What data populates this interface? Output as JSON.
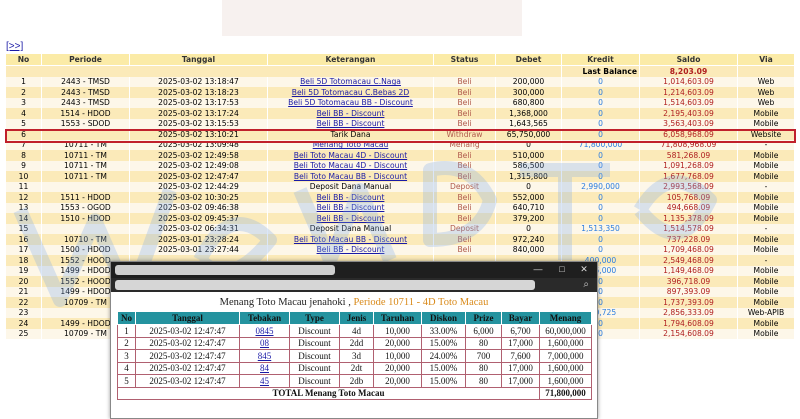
{
  "expand_label": "[>>]",
  "headers": [
    "No",
    "Periode",
    "Tanggal",
    "Keterangan",
    "Status",
    "Debet",
    "Kredit",
    "Saldo",
    "Via"
  ],
  "last_balance": {
    "label": "Last Balance",
    "value": "8,203.09"
  },
  "rows": [
    {
      "no": "1",
      "periode": "2443 - TMSD",
      "tanggal": "2025-03-02 13:18:47",
      "ket": "Beli 5D Totomacau C.Naga",
      "link": true,
      "status": "Beli",
      "debet": "200,000",
      "kredit": "0",
      "saldo": "1,014,603.09",
      "via": "Web"
    },
    {
      "no": "2",
      "periode": "2443 - TMSD",
      "tanggal": "2025-03-02 13:18:23",
      "ket": "Beli 5D Totomacau C.Bebas 2D",
      "link": true,
      "status": "Beli",
      "debet": "300,000",
      "kredit": "0",
      "saldo": "1,214,603.09",
      "via": "Web"
    },
    {
      "no": "3",
      "periode": "2443 - TMSD",
      "tanggal": "2025-03-02 13:17:53",
      "ket": "Beli 5D Totomacau BB - Discount",
      "link": true,
      "status": "Beli",
      "debet": "680,800",
      "kredit": "0",
      "saldo": "1,514,603.09",
      "via": "Web"
    },
    {
      "no": "4",
      "periode": "1514 - HDOD",
      "tanggal": "2025-03-02 13:17:24",
      "ket": "Beli BB - Discount",
      "link": true,
      "status": "Beli",
      "debet": "1,368,000",
      "kredit": "0",
      "saldo": "2,195,403.09",
      "via": "Mobile"
    },
    {
      "no": "5",
      "periode": "1553 - SDOD",
      "tanggal": "2025-03-02 13:15:53",
      "ket": "Beli BB - Discount",
      "link": true,
      "status": "Beli",
      "debet": "1,643,565",
      "kredit": "0",
      "saldo": "3,563,403.09",
      "via": "Mobile"
    },
    {
      "no": "6",
      "periode": "",
      "tanggal": "2025-03-02 13:10:21",
      "ket": "Tarik Dana",
      "link": false,
      "status": "Withdraw",
      "debet": "65,750,000",
      "kredit": "0",
      "saldo": "6,058,968.09",
      "via": "Website"
    },
    {
      "no": "7",
      "periode": "10711 - TM",
      "tanggal": "2025-03-02 13:09:48",
      "ket": "Menang Toto Macau",
      "link": true,
      "status": "Menang",
      "debet": "0",
      "kredit": "71,800,000",
      "saldo": "71,808,968.09",
      "via": "-"
    },
    {
      "no": "8",
      "periode": "10711 - TM",
      "tanggal": "2025-03-02 12:49:58",
      "ket": "Beli Toto Macau 4D - Discount",
      "link": true,
      "status": "Beli",
      "debet": "510,000",
      "kredit": "0",
      "saldo": "581,268.09",
      "via": "Mobile"
    },
    {
      "no": "9",
      "periode": "10711 - TM",
      "tanggal": "2025-03-02 12:49:08",
      "ket": "Beli Toto Macau 4D - Discount",
      "link": true,
      "status": "Beli",
      "debet": "586,500",
      "kredit": "0",
      "saldo": "1,091,268.09",
      "via": "Mobile"
    },
    {
      "no": "10",
      "periode": "10711 - TM",
      "tanggal": "2025-03-02 12:47:47",
      "ket": "Beli Toto Macau BB - Discount",
      "link": true,
      "status": "Beli",
      "debet": "1,315,800",
      "kredit": "0",
      "saldo": "1,677,768.09",
      "via": "Mobile"
    },
    {
      "no": "11",
      "periode": "",
      "tanggal": "2025-03-02 12:44:29",
      "ket": "Deposit Dana Manual",
      "link": false,
      "status": "Deposit",
      "debet": "0",
      "kredit": "2,990,000",
      "saldo": "2,993,568.09",
      "via": "-"
    },
    {
      "no": "12",
      "periode": "1511 - HDOD",
      "tanggal": "2025-03-02 10:30:25",
      "ket": "Beli BB - Discount",
      "link": true,
      "status": "Beli",
      "debet": "552,000",
      "kredit": "0",
      "saldo": "105,768.09",
      "via": "Mobile"
    },
    {
      "no": "13",
      "periode": "1553 - OGOD",
      "tanggal": "2025-03-02 09:46:38",
      "ket": "Beli BB - Discount",
      "link": true,
      "status": "Beli",
      "debet": "640,710",
      "kredit": "0",
      "saldo": "494,668.09",
      "via": "Mobile"
    },
    {
      "no": "14",
      "periode": "1510 - HDOD",
      "tanggal": "2025-03-02 09:45:37",
      "ket": "Beli BB - Discount",
      "link": true,
      "status": "Beli",
      "debet": "379,200",
      "kredit": "0",
      "saldo": "1,135,378.09",
      "via": "Mobile"
    },
    {
      "no": "15",
      "periode": "",
      "tanggal": "2025-03-02 06:34:31",
      "ket": "Deposit Dana Manual",
      "link": false,
      "status": "Deposit",
      "debet": "0",
      "kredit": "1,513,350",
      "saldo": "1,514,578.09",
      "via": "-"
    },
    {
      "no": "16",
      "periode": "10710 - TM",
      "tanggal": "2025-03-01 23:28:24",
      "ket": "Beli Toto Macau BB - Discount",
      "link": true,
      "status": "Beli",
      "debet": "972,240",
      "kredit": "0",
      "saldo": "737,228.09",
      "via": "Mobile"
    },
    {
      "no": "17",
      "periode": "1500 - HDOD",
      "tanggal": "2025-03-01 23:27:44",
      "ket": "Beli BB - Discount",
      "link": true,
      "status": "Beli",
      "debet": "840,000",
      "kredit": "0",
      "saldo": "1,709,468.09",
      "via": "Mobile"
    },
    {
      "no": "18",
      "periode": "1552 - HOOD",
      "tanggal": "",
      "ket": "",
      "link": false,
      "status": "",
      "debet": "",
      "kredit": "400,000",
      "saldo": "2,549,468.09",
      "via": "-"
    },
    {
      "no": "19",
      "periode": "1499 - HDOD",
      "tanggal": "",
      "ket": "",
      "link": false,
      "status": "",
      "debet": "",
      "kredit": "125,000",
      "saldo": "1,149,468.09",
      "via": "Mobile"
    },
    {
      "no": "20",
      "periode": "1552 - HOOD",
      "tanggal": "",
      "ket": "",
      "link": false,
      "status": "",
      "debet": "",
      "kredit": "0",
      "saldo": "396,718.09",
      "via": "Mobile"
    },
    {
      "no": "21",
      "periode": "1499 - HDOD",
      "tanggal": "",
      "ket": "",
      "link": false,
      "status": "",
      "debet": "",
      "kredit": "0",
      "saldo": "897,393.09",
      "via": "Mobile"
    },
    {
      "no": "22",
      "periode": "10709 - TM",
      "tanggal": "",
      "ket": "",
      "link": false,
      "status": "",
      "debet": "",
      "kredit": "0",
      "saldo": "1,737,393.09",
      "via": "Mobile"
    },
    {
      "no": "23",
      "periode": "",
      "tanggal": "",
      "ket": "",
      "link": false,
      "status": "",
      "debet": "",
      "kredit": "850,725",
      "saldo": "2,856,333.09",
      "via": "Web-APIB"
    },
    {
      "no": "24",
      "periode": "1499 - HDOD",
      "tanggal": "",
      "ket": "",
      "link": false,
      "status": "",
      "debet": "",
      "kredit": "0",
      "saldo": "1,794,608.09",
      "via": "Mobile"
    },
    {
      "no": "25",
      "periode": "10709 - TM",
      "tanggal": "",
      "ket": "",
      "link": false,
      "status": "",
      "debet": "",
      "kredit": "0",
      "saldo": "2,154,608.09",
      "via": "Mobile"
    }
  ],
  "popup": {
    "window_buttons": {
      "minimize": "—",
      "maximize": "□",
      "close": "✕"
    },
    "zoom_icon": "⌕",
    "heading_main": "Menang Toto Macau jenahoki ,",
    "heading_period": " Periode 10711 - 4D Toto Macau",
    "headers": [
      "No",
      "Tanggal",
      "Tebakan",
      "Type",
      "Jenis",
      "Taruhan",
      "Diskon",
      "Prize",
      "Bayar",
      "Menang"
    ],
    "rows": [
      {
        "no": "1",
        "tanggal": "2025-03-02 12:47:47",
        "tebakan": "0845",
        "type": "Discount",
        "jenis": "4d",
        "taruhan": "10,000",
        "diskon": "33.00%",
        "prize": "6,000",
        "bayar": "6,700",
        "menang": "60,000,000"
      },
      {
        "no": "2",
        "tanggal": "2025-03-02 12:47:47",
        "tebakan": "08",
        "type": "Discount",
        "jenis": "2dd",
        "taruhan": "20,000",
        "diskon": "15.00%",
        "prize": "80",
        "bayar": "17,000",
        "menang": "1,600,000"
      },
      {
        "no": "3",
        "tanggal": "2025-03-02 12:47:47",
        "tebakan": "845",
        "type": "Discount",
        "jenis": "3d",
        "taruhan": "10,000",
        "diskon": "24.00%",
        "prize": "700",
        "bayar": "7,600",
        "menang": "7,000,000"
      },
      {
        "no": "4",
        "tanggal": "2025-03-02 12:47:47",
        "tebakan": "84",
        "type": "Discount",
        "jenis": "2dt",
        "taruhan": "20,000",
        "diskon": "15.00%",
        "prize": "80",
        "bayar": "17,000",
        "menang": "1,600,000"
      },
      {
        "no": "5",
        "tanggal": "2025-03-02 12:47:47",
        "tebakan": "45",
        "type": "Discount",
        "jenis": "2db",
        "taruhan": "20,000",
        "diskon": "15.00%",
        "prize": "80",
        "bayar": "17,000",
        "menang": "1,600,000"
      }
    ],
    "total_label": "TOTAL  Menang Toto Macau",
    "total_value": "71,800,000"
  },
  "colors": {
    "header_bg": "#fbeba7",
    "row_light": "#fdf7e9",
    "row_dark": "#fbeab9",
    "highlight": "#c0202c",
    "popup_header": "#24939f"
  }
}
